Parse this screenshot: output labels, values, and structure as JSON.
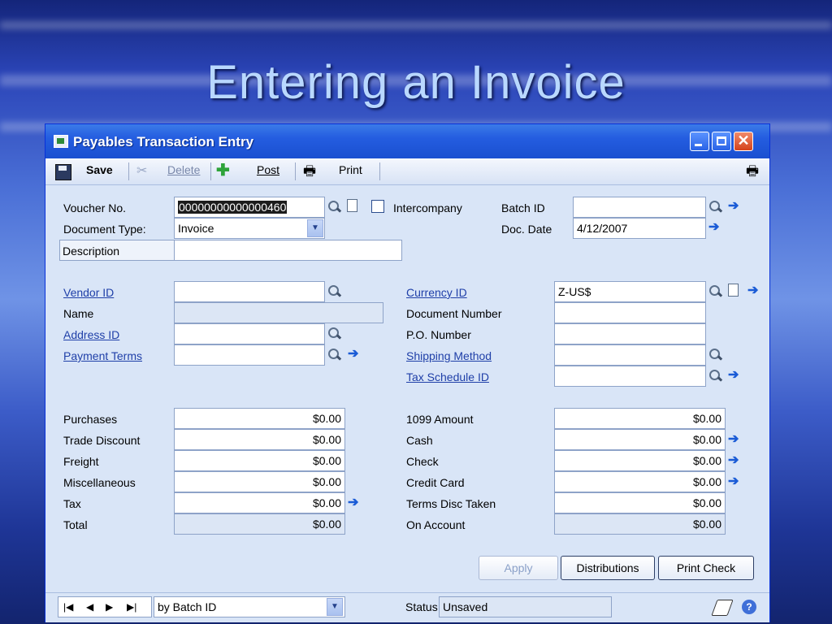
{
  "slide": {
    "title": "Entering an Invoice"
  },
  "window": {
    "title": "Payables Transaction Entry"
  },
  "toolbar": {
    "save": "Save",
    "delete": "Delete",
    "post": "Post",
    "print": "Print"
  },
  "header": {
    "voucher_label": "Voucher No.",
    "voucher_value": "00000000000000460",
    "intercompany_label": "Intercompany",
    "intercompany_checked": false,
    "batch_label": "Batch ID",
    "batch_value": "",
    "doctype_label": "Document Type:",
    "doctype_value": "Invoice",
    "docdate_label": "Doc. Date",
    "docdate_value": "4/12/2007",
    "description_label": "Description",
    "description_value": ""
  },
  "vendor": {
    "vendor_id_label": "Vendor ID",
    "vendor_id_value": "",
    "name_label": "Name",
    "name_value": "",
    "address_label": "Address ID",
    "address_value": "",
    "terms_label": "Payment Terms",
    "terms_value": ""
  },
  "doc": {
    "currency_label": "Currency ID",
    "currency_value": "Z-US$",
    "docnum_label": "Document Number",
    "docnum_value": "",
    "po_label": "P.O. Number",
    "po_value": "",
    "ship_label": "Shipping Method",
    "ship_value": "",
    "tax_sched_label": "Tax Schedule ID",
    "tax_sched_value": ""
  },
  "amounts_left": [
    {
      "label": "Purchases",
      "value": "$0.00"
    },
    {
      "label": "Trade Discount",
      "value": "$0.00"
    },
    {
      "label": "Freight",
      "value": "$0.00"
    },
    {
      "label": "Miscellaneous",
      "value": "$0.00"
    },
    {
      "label": "Tax",
      "value": "$0.00"
    },
    {
      "label": "Total",
      "value": "$0.00"
    }
  ],
  "amounts_right": [
    {
      "label": "1099 Amount",
      "value": "$0.00"
    },
    {
      "label": "Cash",
      "value": "$0.00"
    },
    {
      "label": "Check",
      "value": "$0.00"
    },
    {
      "label": "Credit Card",
      "value": "$0.00"
    },
    {
      "label": "Terms Disc Taken",
      "value": "$0.00"
    },
    {
      "label": "On Account",
      "value": "$0.00"
    }
  ],
  "buttons": {
    "apply": "Apply",
    "distributions": "Distributions",
    "print_check": "Print Check"
  },
  "footer": {
    "sort_value": "by Batch ID",
    "status_label": "Status",
    "status_value": "Unsaved"
  },
  "icons": {
    "save": "floppy-disk-icon",
    "delete": "scissors-icon",
    "post": "post-icon",
    "print": "printer-icon",
    "lookup": "magnifier-icon",
    "new": "new-document-icon",
    "expand": "blue-arrow-icon",
    "note": "note-icon",
    "help": "help-icon"
  },
  "colors": {
    "title_bar": "#245de0",
    "form_bg": "#d9e5f7",
    "link": "#1f3fa8",
    "arrow": "#1a5bd6"
  }
}
